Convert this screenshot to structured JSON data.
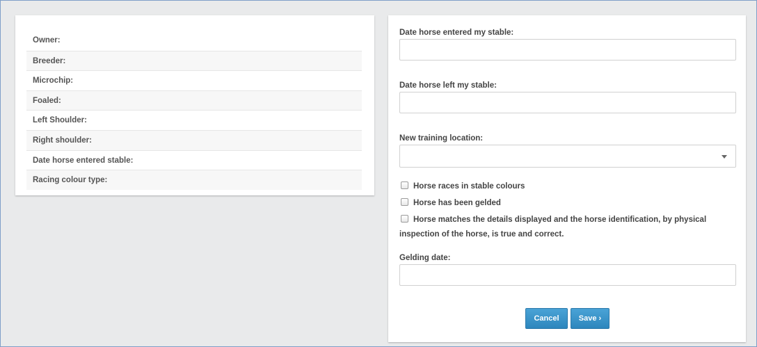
{
  "details": {
    "rows": [
      "Owner:",
      "Breeder:",
      "Microchip:",
      "Foaled:",
      "Left Shoulder:",
      "Right shoulder:",
      "Date horse entered stable:",
      "Racing colour type:"
    ]
  },
  "form": {
    "entered_label": "Date horse entered my stable:",
    "entered_value": "",
    "left_label": "Date horse left my stable:",
    "left_value": "",
    "location_label": "New training location:",
    "location_selected": "",
    "checks": {
      "stable_colours": "Horse races in stable colours",
      "gelded": "Horse has been gelded",
      "matches_line1": "Horse matches the details displayed and the horse identification, by physical",
      "matches_line2": "inspection of the horse, is true and correct."
    },
    "gelding_label": "Gelding date:",
    "gelding_value": "",
    "cancel_label": "Cancel",
    "save_label": "Save ›"
  },
  "colors": {
    "accent": "#3a96cc",
    "background": "#e9eaeb"
  }
}
